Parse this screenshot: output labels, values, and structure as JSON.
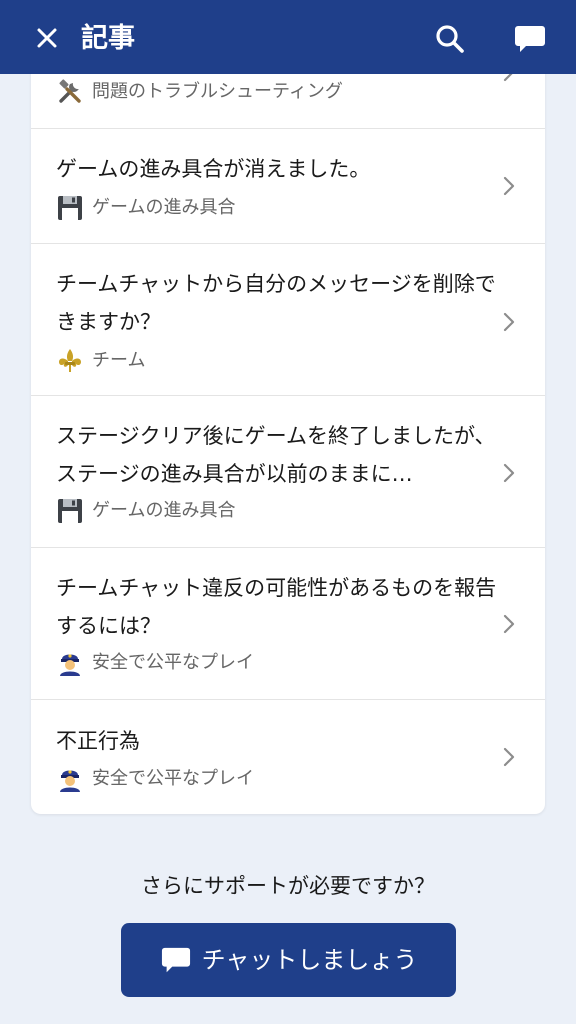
{
  "header": {
    "title": "記事",
    "background": "#1f3f8a"
  },
  "articles": [
    {
      "title": "",
      "category": "問題のトラブルシューティング",
      "category_icon": "tools-icon"
    },
    {
      "title": "ゲームの進み具合が消えました。",
      "category": "ゲームの進み具合",
      "category_icon": "floppy-disk-icon"
    },
    {
      "title": "チームチャットから自分のメッセージを削除できますか？",
      "category": "チーム",
      "category_icon": "fleur-de-lis-icon"
    },
    {
      "title": "ステージクリア後にゲームを終了しましたが、ステージの進み具合が以前のままに…",
      "category": "ゲームの進み具合",
      "category_icon": "floppy-disk-icon"
    },
    {
      "title": "チームチャット違反の可能性があるものを報告するには？",
      "category": "安全で公平なプレイ",
      "category_icon": "police-officer-icon"
    },
    {
      "title": "不正行為",
      "category": "安全で公平なプレイ",
      "category_icon": "police-officer-icon"
    }
  ],
  "footer": {
    "help_text": "さらにサポートが必要ですか？",
    "cta_label": "チャットしましょう",
    "cta_icon": "chat-bubble-icon",
    "cta_color": "#1f3f8a"
  }
}
